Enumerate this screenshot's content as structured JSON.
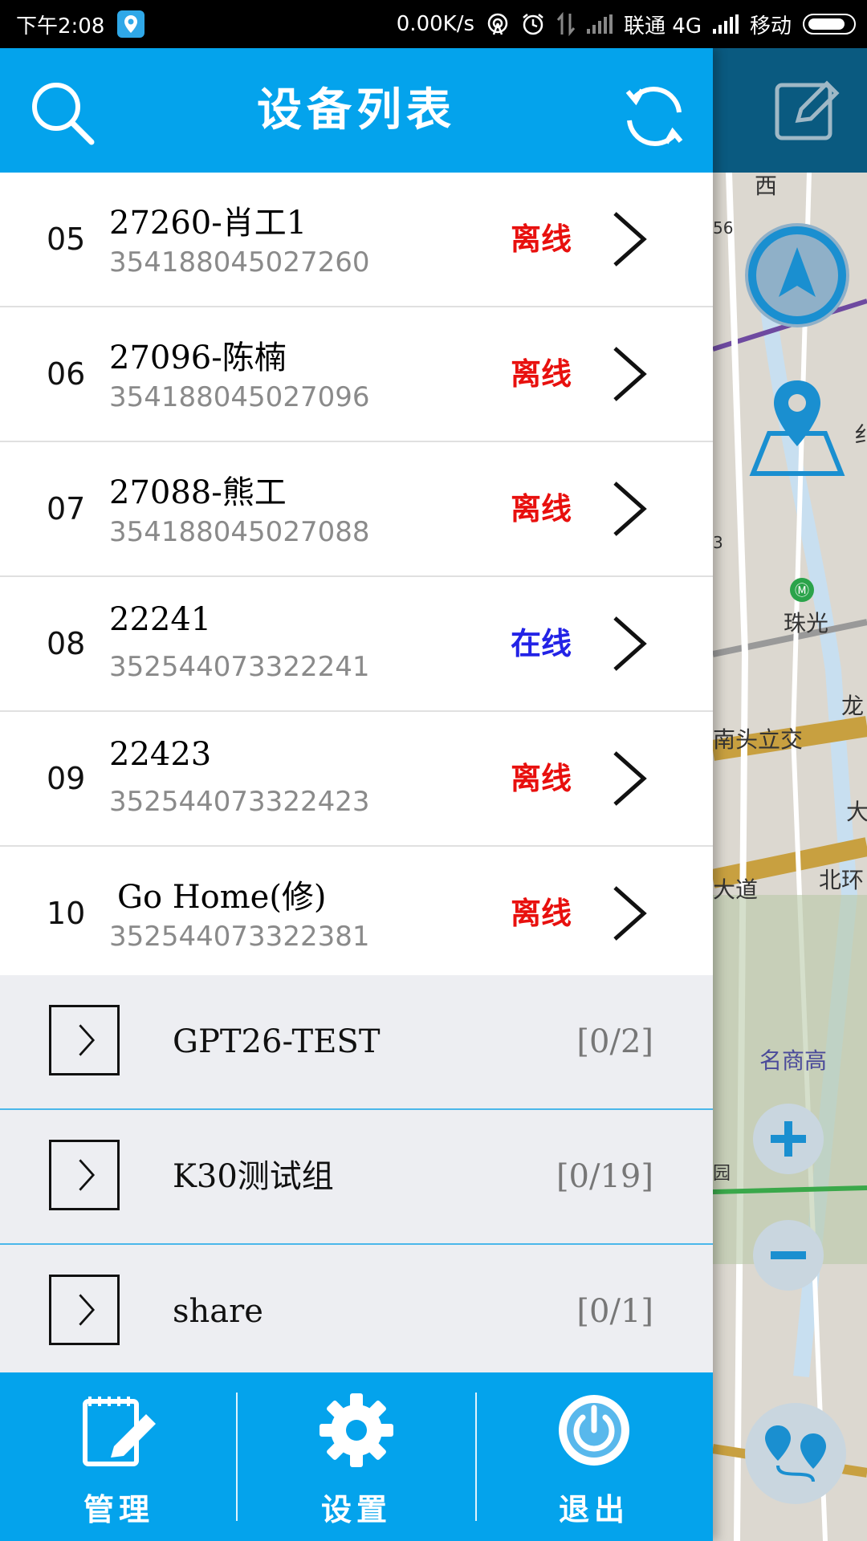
{
  "status_bar": {
    "time": "下午2:08",
    "speed": "0.00K/s",
    "carrier1": "联通 4G",
    "carrier2": "移动"
  },
  "header": {
    "title": "设备列表",
    "search_icon": "search-icon",
    "refresh_icon": "refresh-icon",
    "edit_icon": "edit-icon"
  },
  "devices": [
    {
      "index": "05",
      "name": "27260-肖工1",
      "imei": "354188045027260",
      "status": "离线",
      "status_color": "#e8100e"
    },
    {
      "index": "06",
      "name": "27096-陈楠",
      "imei": "354188045027096",
      "status": "离线",
      "status_color": "#e8100e"
    },
    {
      "index": "07",
      "name": "27088-熊工",
      "imei": "354188045027088",
      "status": "离线",
      "status_color": "#e8100e"
    },
    {
      "index": "08",
      "name": "22241",
      "imei": "352544073322241",
      "status": "在线",
      "status_color": "#2323e6"
    },
    {
      "index": "09",
      "name": "22423",
      "imei": "352544073322423",
      "status": "离线",
      "status_color": "#e8100e"
    },
    {
      "index": "10",
      "name": "Go Home(修)",
      "imei": "352544073322381",
      "status": "离线",
      "status_color": "#e8100e"
    }
  ],
  "groups": [
    {
      "name": "GPT26-TEST",
      "count": "[0/2]"
    },
    {
      "name": "K30测试组",
      "count": "[0/19]"
    },
    {
      "name": "share",
      "count": "[0/1]"
    }
  ],
  "bottom_nav": [
    {
      "label": "管理",
      "icon": "manage-icon"
    },
    {
      "label": "设置",
      "icon": "settings-gear-icon"
    },
    {
      "label": "退出",
      "icon": "power-icon"
    }
  ],
  "map": {
    "labels": [
      "西",
      "56",
      "纟",
      "3",
      "珠光",
      "龙",
      "南头立交",
      "大",
      "大道",
      "北环",
      "名商高",
      "园"
    ]
  },
  "colors": {
    "header_blue": "#04a3ec",
    "offline_red": "#e8100e",
    "online_blue": "#2323e6",
    "group_bg": "#edeef2"
  }
}
